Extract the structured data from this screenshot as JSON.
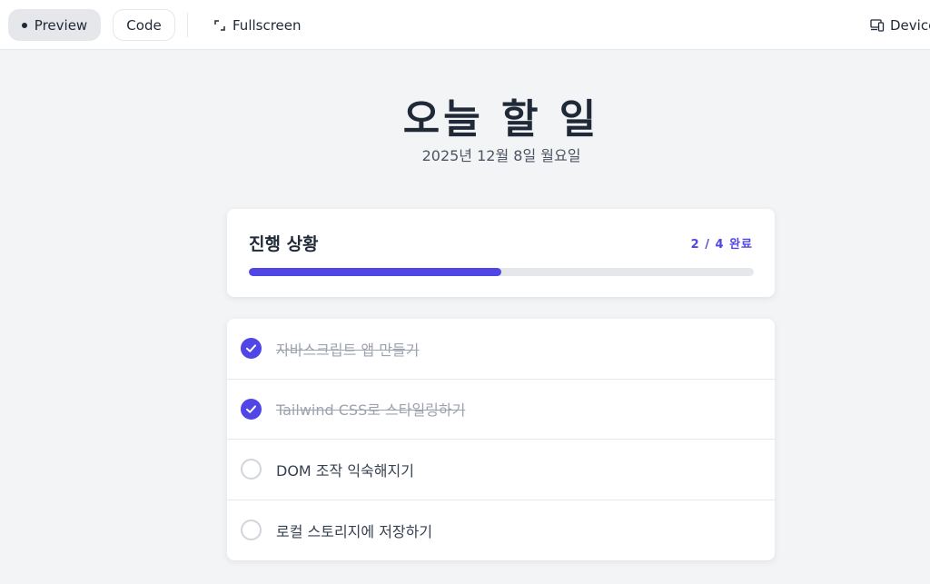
{
  "toolbar": {
    "preview_label": "Preview",
    "code_label": "Code",
    "fullscreen_label": "Fullscreen",
    "device_label": "Device"
  },
  "header": {
    "title": "오늘 할 일",
    "date": "2025년 12월 8일 월요일"
  },
  "progress": {
    "title": "진행 상황",
    "count_text": "2 / 4 완료",
    "completed": 2,
    "total": 4,
    "accent_color": "#4f46e5"
  },
  "tasks": [
    {
      "text": "자바스크립트 앱 만들기",
      "done": true
    },
    {
      "text": "Tailwind CSS로 스타일링하기",
      "done": true
    },
    {
      "text": "DOM 조작 익숙해지기",
      "done": false
    },
    {
      "text": "로컬 스토리지에 저장하기",
      "done": false
    }
  ]
}
